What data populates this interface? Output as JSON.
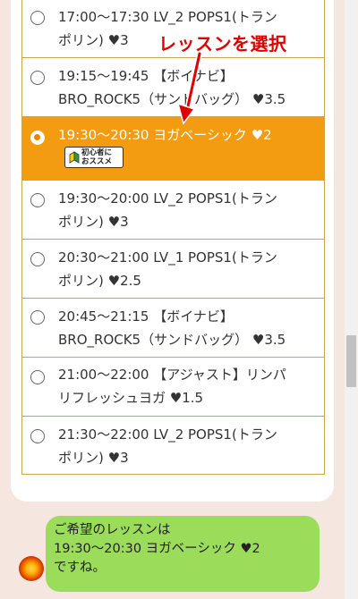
{
  "annotation": {
    "label": "レッスンを選択"
  },
  "lessons": [
    {
      "text": "17:00〜17:30 LV_2 POPS1(トラン\nポリン) ♥3"
    },
    {
      "text": "19:15〜19:45 【ボイナビ】\nBRO_ROCK5（サンドバッグ） ♥3.5"
    },
    {
      "text": "19:30〜20:30 ヨガベーシック ♥2",
      "selected": true
    },
    {
      "text": "19:30〜20:00 LV_2 POPS1(トラン\nポリン) ♥3"
    },
    {
      "text": "20:30〜21:00 LV_1 POPS1(トラン\nポリン) ♥2.5"
    },
    {
      "text": "20:45〜21:15 【ボイナビ】\nBRO_ROCK5（サンドバッグ） ♥3.5"
    },
    {
      "text": "21:00〜22:00 【アジャスト】リンパ\nリフレッシュヨガ ♥1.5"
    },
    {
      "text": "21:30〜22:00 LV_2 POPS1(トラン\nポリン) ♥3"
    }
  ],
  "badge": {
    "line1": "初心者に",
    "line2": "おススメ"
  },
  "chat": {
    "message": "ご希望のレッスンは\n19:30〜20:30 ヨガベーシック ♥2\nですね。"
  },
  "colors": {
    "accent": "#f39c11",
    "border": "#c9a44c",
    "bubble": "#9bdc5a",
    "annotation": "#e00000"
  }
}
